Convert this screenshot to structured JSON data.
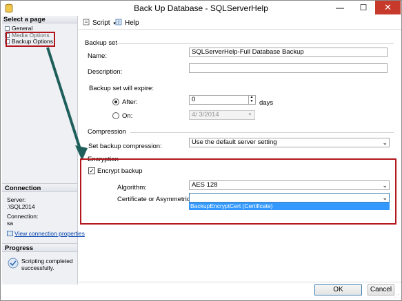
{
  "window": {
    "title": "Back Up Database - SQLServerHelp",
    "minimize_glyph": "—",
    "maximize_glyph": "☐",
    "close_glyph": "✕"
  },
  "sidebar": {
    "select_page_header": "Select a page",
    "pages": [
      {
        "label": "General"
      },
      {
        "label": "Media Options"
      },
      {
        "label": "Backup Options"
      }
    ],
    "connection_header": "Connection",
    "server_label": "Server:",
    "server_value": ".\\SQL2014",
    "connection_label": "Connection:",
    "connection_value": "sa",
    "view_connection_properties": "View connection properties",
    "progress_header": "Progress",
    "progress_text_line1": "Scripting completed",
    "progress_text_line2": "successfully."
  },
  "toolbar": {
    "script_label": "Script",
    "help_label": "Help"
  },
  "backup_set": {
    "section_label": "Backup set",
    "name_label": "Name:",
    "name_value": "SQLServerHelp-Full Database Backup",
    "description_label": "Description:",
    "description_value": "",
    "expire_label": "Backup set will expire:",
    "after_label": "After:",
    "after_value": "0",
    "days_label": "days",
    "on_label": "On:",
    "on_value": "4/  3/2014"
  },
  "compression": {
    "section_label": "Compression",
    "set_label": "Set backup compression:",
    "value": "Use the default server setting"
  },
  "encryption": {
    "section_label": "Encryption",
    "encrypt_label": "Encrypt backup",
    "encrypt_checked": true,
    "algorithm_label": "Algorithm:",
    "algorithm_value": "AES 128",
    "cert_label": "Certificate or Asymmetric key:",
    "cert_value": "",
    "cert_option": "BackupEncryptCert (Certificate)"
  },
  "footer": {
    "ok_label": "OK",
    "cancel_label": "Cancel"
  },
  "colors": {
    "highlight_red": "#b3151c",
    "arrow_teal": "#1f5f5b",
    "selection_blue": "#3399ff",
    "close_red": "#c7392b"
  }
}
